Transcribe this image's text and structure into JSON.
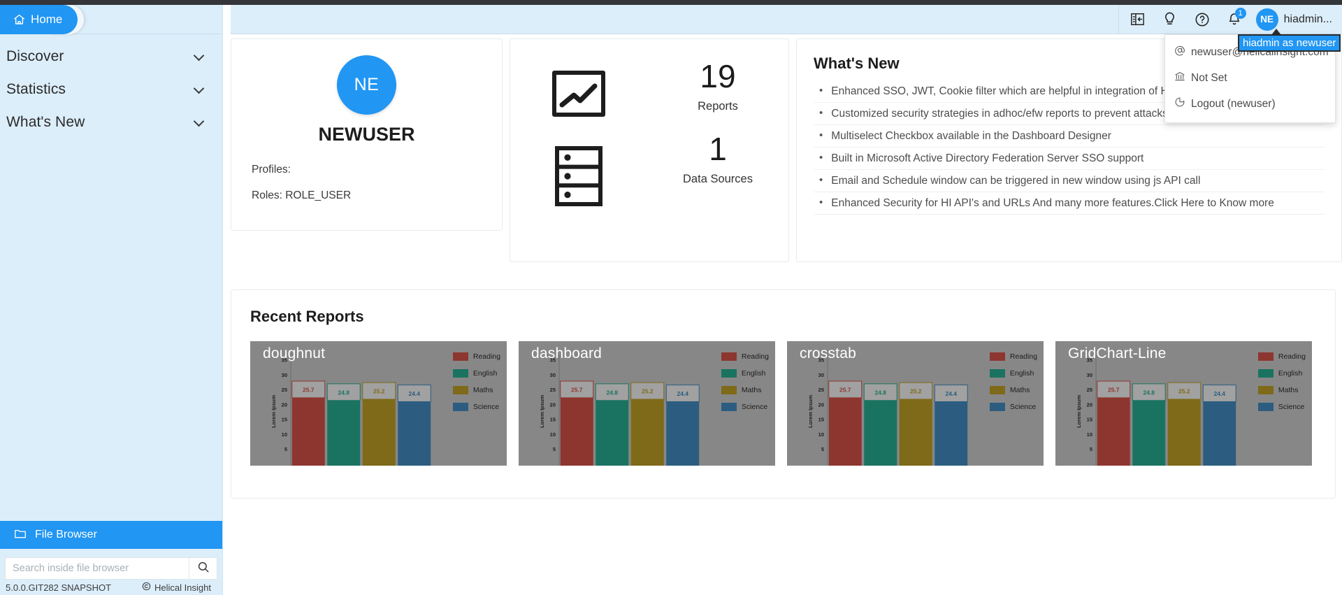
{
  "breadcrumb": {
    "home_label": "Home",
    "next_icon": "chevron-right-icon"
  },
  "sidebar": {
    "items": [
      {
        "label": "Discover"
      },
      {
        "label": "Statistics"
      },
      {
        "label": "What's New"
      }
    ],
    "file_browser_label": "File Browser",
    "search_placeholder": "Search inside file browser",
    "search_value": "",
    "version": "5.0.0.GIT282 SNAPSHOT",
    "brand": "Helical Insight"
  },
  "topbar": {
    "icons": [
      "panel-toggle-icon",
      "lightbulb-icon",
      "help-circle-icon",
      "bell-icon"
    ],
    "notification_count": "1",
    "user_initials": "NE",
    "user_name": "hiadmin...",
    "tooltip": "hiadmin as newuser"
  },
  "user_menu": {
    "items": [
      {
        "icon": "at-sign-icon",
        "label": "newuser@helicalinsight.com"
      },
      {
        "icon": "bank-icon",
        "label": "Not Set"
      },
      {
        "icon": "logout-icon",
        "label": "Logout (newuser)"
      }
    ]
  },
  "profile_card": {
    "initials": "NE",
    "name": "NEWUSER",
    "profiles_label": "Profiles:",
    "roles_label": "Roles: ROLE_USER"
  },
  "stats_card": {
    "reports": {
      "icon": "line-chart-icon",
      "value": "19",
      "label": "Reports"
    },
    "data_sources": {
      "icon": "database-icon",
      "value": "1",
      "label": "Data Sources"
    }
  },
  "whats_new": {
    "title": "What's New",
    "items": [
      "Enhanced SSO, JWT, Cookie filter which are helpful in integration of HI with other application",
      "Customized security strategies in adhoc/efw reports to prevent attacks",
      "Multiselect Checkbox available in the Dashboard Designer",
      "Built in Microsoft Active Directory Federation Server SSO support",
      "Email and Schedule window can be triggered in new window using js API call",
      "Enhanced Security for HI API's and URLs And many more features.Click Here to Know more"
    ]
  },
  "recent_reports": {
    "title": "Recent Reports",
    "items": [
      {
        "title": "doughnut"
      },
      {
        "title": "dashboard"
      },
      {
        "title": "crosstab"
      },
      {
        "title": "GridChart-Line"
      }
    ]
  },
  "chart_data": {
    "type": "bar",
    "title": "doughnut",
    "categories": [
      "Reading",
      "English",
      "Maths",
      "Science"
    ],
    "values": [
      25.7,
      24.8,
      25.2,
      24.4
    ],
    "data_labels": [
      "25.7",
      "24.8",
      "25.2",
      "24.4"
    ],
    "colors": [
      "#8d3630",
      "#1a7360",
      "#7e6a18",
      "#2c5d80"
    ],
    "legend": [
      "Reading",
      "English",
      "Maths",
      "Science"
    ],
    "legend_position": "right",
    "xlabel": "",
    "ylabel": "Lorem Ipsum",
    "ylim": [
      0,
      35
    ],
    "yticks": [
      5,
      10,
      15,
      20,
      25,
      30,
      35
    ],
    "grid": false,
    "plot_background": "#878787"
  },
  "colors": {
    "accent": "#2196f3",
    "sidebar_bg": "#dceefa",
    "topbar_bg": "#dceefa",
    "dark_strip": "#35363a"
  }
}
